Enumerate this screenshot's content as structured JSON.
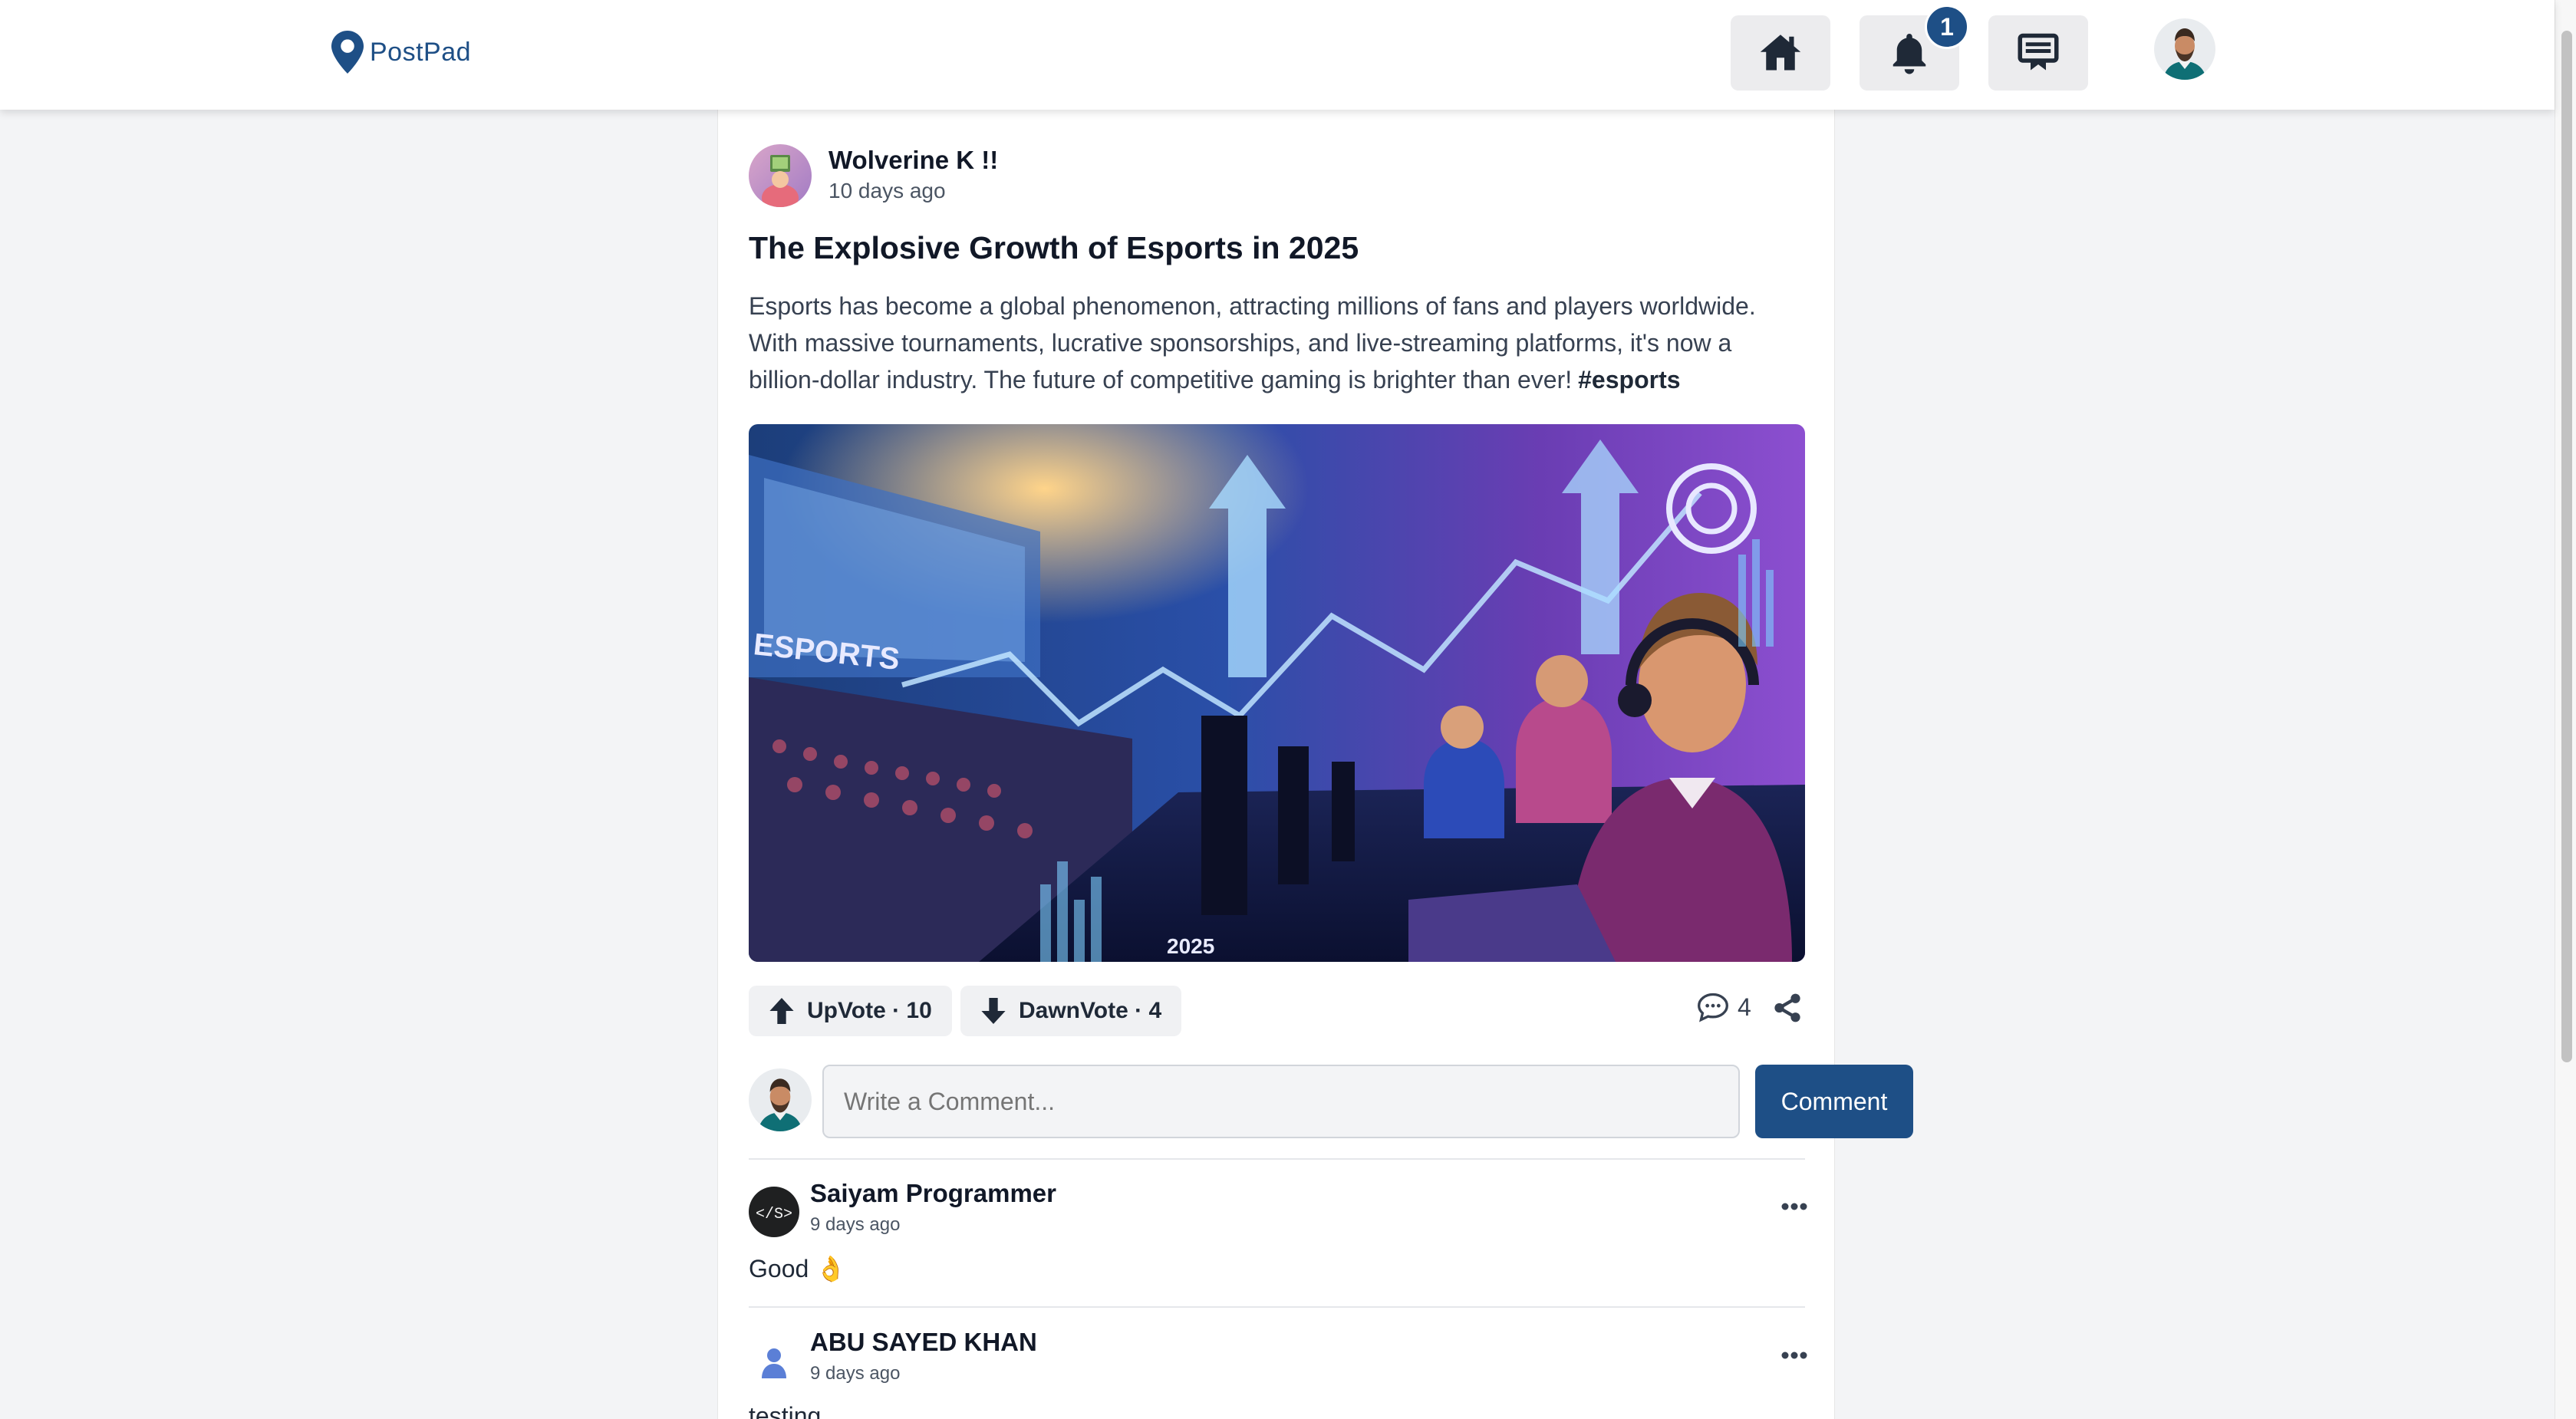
{
  "header": {
    "logo_text": "PostPad",
    "notification_count": "1"
  },
  "post": {
    "author_name": "Wolverine K !!",
    "time": "10 days ago",
    "title": "The Explosive Growth of Esports in 2025",
    "body": "Esports has become a global phenomenon, attracting millions of fans and players worldwide. With massive tournaments, lucrative sponsorships, and live-streaming platforms, it's now a billion-dollar industry. The future of competitive gaming is brighter than ever!",
    "hashtag": "#esports",
    "image_text_esports": "ESPORTS",
    "image_text_year": "2025",
    "upvote_label": "UpVote · 10",
    "downvote_label": "DawnVote · 4",
    "comment_count": "4"
  },
  "comment_form": {
    "placeholder": "Write a Comment...",
    "submit_label": "Comment"
  },
  "comments": [
    {
      "author": "Saiyam Programmer",
      "time": "9 days ago",
      "text": "Good 👌",
      "avatar_text": "</S>"
    },
    {
      "author": "ABU SAYED KHAN",
      "time": "9 days ago",
      "text": "testing"
    }
  ],
  "colors": {
    "brand": "#1e4f86",
    "page_bg": "#f3f4f6",
    "button_bg": "#f0f1f3"
  },
  "icons": [
    "location-pin-icon",
    "home-icon",
    "bell-icon",
    "message-icon",
    "arrow-up-icon",
    "arrow-down-icon",
    "comment-bubble-icon",
    "share-icon",
    "more-horizontal-icon",
    "user-icon"
  ]
}
